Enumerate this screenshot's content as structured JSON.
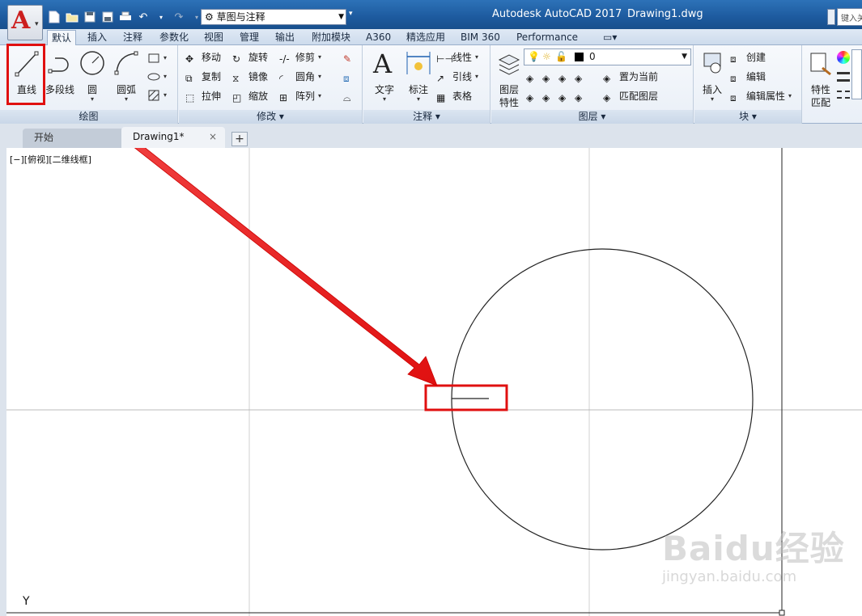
{
  "title_bar": {
    "app_title": "Autodesk AutoCAD 2017",
    "document_title": "Drawing1.dwg",
    "workspace": "草图与注释",
    "search_placeholder": "键入关"
  },
  "ribbon_tabs": [
    "默认",
    "插入",
    "注释",
    "参数化",
    "视图",
    "管理",
    "输出",
    "附加模块",
    "A360",
    "精选应用",
    "BIM 360",
    "Performance"
  ],
  "active_tab": "默认",
  "draw_panel": {
    "label": "绘图",
    "line": "直线",
    "polyline": "多段线",
    "circle": "圆",
    "arc": "圆弧"
  },
  "modify_panel": {
    "label": "修改",
    "move": "移动",
    "rotate": "旋转",
    "trim": "修剪",
    "copy": "复制",
    "mirror": "镜像",
    "fillet": "圆角",
    "stretch": "拉伸",
    "scale": "缩放",
    "array": "阵列"
  },
  "annotation_panel": {
    "label": "注释",
    "text": "文字",
    "dimension": "标注",
    "linear": "线性",
    "leader": "引线",
    "table": "表格"
  },
  "layers_panel": {
    "label": "图层",
    "layer_properties_1": "图层",
    "layer_properties_2": "特性",
    "current_layer": "0",
    "make_current": "置为当前",
    "match_layer": "匹配图层"
  },
  "block_panel": {
    "label": "块",
    "insert": "插入",
    "create": "创建",
    "edit": "编辑",
    "edit_attributes": "编辑属性"
  },
  "properties_panel": {
    "match_1": "特性",
    "match_2": "匹配"
  },
  "file_tabs": {
    "start": "开始",
    "drawing": "Drawing1*",
    "close": "×",
    "add": "+"
  },
  "canvas": {
    "viewport_label": "[−][俯视][二维线框]",
    "ucs_axis": "Y"
  },
  "watermark": {
    "brand": "Baidu经验",
    "url": "jingyan.baidu.com"
  },
  "colors": {
    "highlight": "#e01010",
    "title_bar": "#1d5a9e"
  }
}
